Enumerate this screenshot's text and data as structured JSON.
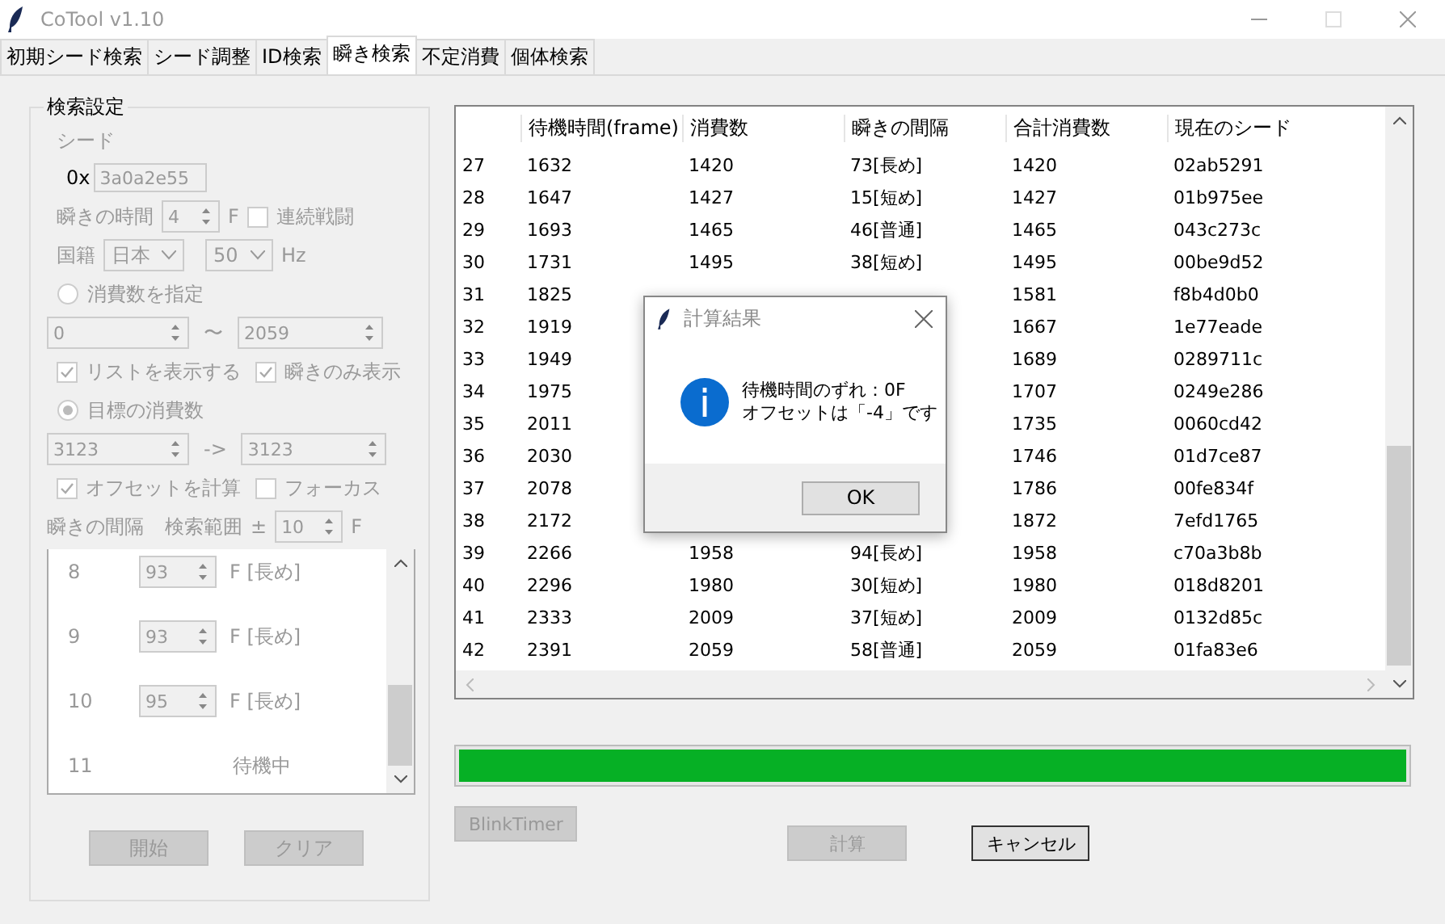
{
  "window": {
    "title": "CoTool v1.10"
  },
  "tabs": [
    {
      "label": "初期シード検索",
      "selected": false
    },
    {
      "label": "シード調整",
      "selected": false
    },
    {
      "label": "ID検索",
      "selected": false
    },
    {
      "label": "瞬き検索",
      "selected": true
    },
    {
      "label": "不定消費",
      "selected": false
    },
    {
      "label": "個体検索",
      "selected": false
    }
  ],
  "settings": {
    "title": "検索設定",
    "disabled": true,
    "seed_label": "シード",
    "seed_prefix": "0x",
    "seed_value": "3a0a2e55",
    "blink_time_label": "瞬きの時間",
    "blink_time_value": "4",
    "blink_time_unit": "F",
    "continuous_battle": {
      "label": "連続戦闘",
      "checked": false
    },
    "region_label": "国籍",
    "region_value": "日本",
    "hz_value": "50",
    "hz_unit": "Hz",
    "specify_consumption": {
      "label": "消費数を指定",
      "selected": false
    },
    "range_from": "0",
    "range_sep": "〜",
    "range_to": "2059",
    "show_list": {
      "label": "リストを表示する",
      "checked": true
    },
    "blink_only": {
      "label": "瞬きのみ表示",
      "checked": true
    },
    "target_consumption": {
      "label": "目標の消費数",
      "selected": true
    },
    "target_from": "3123",
    "target_sep": "->",
    "target_to": "3123",
    "calc_offset": {
      "label": "オフセットを計算",
      "checked": true
    },
    "focus": {
      "label": "フォーカス",
      "checked": false
    },
    "interval_label": "瞬きの間隔",
    "search_range_label": "検索範囲",
    "search_range_pm": "±",
    "search_range_value": "10",
    "search_range_unit": "F",
    "intervals": [
      {
        "index": "8",
        "value": "93",
        "label": "F [長め]"
      },
      {
        "index": "9",
        "value": "93",
        "label": "F [長め]"
      },
      {
        "index": "10",
        "value": "95",
        "label": "F [長め]"
      },
      {
        "index": "11",
        "status": "待機中"
      }
    ],
    "buttons": [
      {
        "label": "開始",
        "disabled": true
      },
      {
        "label": "クリア",
        "disabled": true
      }
    ]
  },
  "table": {
    "columns": [
      "",
      "待機時間(frame)",
      "消費数",
      "瞬きの間隔",
      "合計消費数",
      "現在のシード"
    ],
    "rows": [
      [
        "27",
        "1632",
        "1420",
        "73[長め]",
        "1420",
        "02ab5291"
      ],
      [
        "28",
        "1647",
        "1427",
        "15[短め]",
        "1427",
        "01b975ee"
      ],
      [
        "29",
        "1693",
        "1465",
        "46[普通]",
        "1465",
        "043c273c"
      ],
      [
        "30",
        "1731",
        "1495",
        "38[短め]",
        "1495",
        "00be9d52"
      ],
      [
        "31",
        "1825",
        null,
        null,
        "1581",
        "f8b4d0b0"
      ],
      [
        "32",
        "1919",
        null,
        null,
        "1667",
        "1e77eade"
      ],
      [
        "33",
        "1949",
        null,
        null,
        "1689",
        "0289711c"
      ],
      [
        "34",
        "1975",
        null,
        null,
        "1707",
        "0249e286"
      ],
      [
        "35",
        "2011",
        null,
        null,
        "1735",
        "0060cd42"
      ],
      [
        "36",
        "2030",
        null,
        null,
        "1746",
        "01d7ce87"
      ],
      [
        "37",
        "2078",
        null,
        null,
        "1786",
        "00fe834f"
      ],
      [
        "38",
        "2172",
        null,
        null,
        "1872",
        "7efd1765"
      ],
      [
        "39",
        "2266",
        "1958",
        "94[長め]",
        "1958",
        "c70a3b8b"
      ],
      [
        "40",
        "2296",
        "1980",
        "30[短め]",
        "1980",
        "018d8201"
      ],
      [
        "41",
        "2333",
        "2009",
        "37[短め]",
        "2009",
        "0132d85c"
      ],
      [
        "42",
        "2391",
        "2059",
        "58[普通]",
        "2059",
        "01fa83e6"
      ]
    ]
  },
  "progress": {
    "level": 1
  },
  "buttons": [
    {
      "label": "BlinkTimer",
      "disabled": true
    },
    {
      "label": "計算",
      "disabled": true
    },
    {
      "label": "キャンセル",
      "disabled": false
    }
  ],
  "dialog": {
    "title": "計算結果",
    "lines": [
      "待機時間のずれ：0F",
      "オフセットは「-4」です"
    ],
    "button": "OK"
  }
}
